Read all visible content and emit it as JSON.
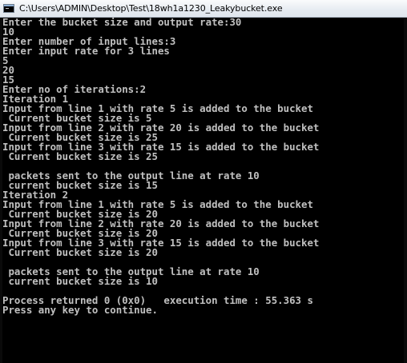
{
  "window": {
    "title": "C:\\Users\\ADMIN\\Desktop\\Test\\18wh1a1230_Leakybucket.exe",
    "icon": "console-window-icon"
  },
  "colors": {
    "console_background": "#000000",
    "console_text": "#c0c0c0",
    "titlebar": "#e6ebf1"
  },
  "console": {
    "lines": [
      "Enter the bucket size and output rate:30",
      "10",
      "Enter number of input lines:3",
      "Enter input rate for 3 lines",
      "5",
      "20",
      "15",
      "Enter no of iterations:2",
      "Iteration 1",
      "Input from line 1 with rate 5 is added to the bucket",
      " Current bucket size is 5",
      "Input from line 2 with rate 20 is added to the bucket",
      " Current bucket size is 25",
      "Input from line 3 with rate 15 is added to the bucket",
      " Current bucket size is 25",
      "",
      " packets sent to the output line at rate 10",
      " current bucket size is 15",
      "Iteration 2",
      "Input from line 1 with rate 5 is added to the bucket",
      " Current bucket size is 20",
      "Input from line 2 with rate 20 is added to the bucket",
      " Current bucket size is 20",
      "Input from line 3 with rate 15 is added to the bucket",
      " Current bucket size is 20",
      "",
      " packets sent to the output line at rate 10",
      " current bucket size is 10",
      "",
      "Process returned 0 (0x0)   execution time : 55.363 s",
      "Press any key to continue."
    ]
  }
}
